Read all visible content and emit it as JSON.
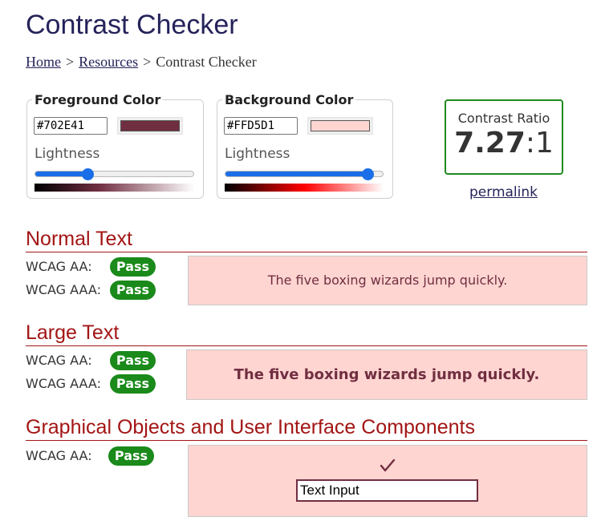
{
  "page": {
    "title": "Contrast Checker",
    "breadcrumb": {
      "home": "Home",
      "resources": "Resources",
      "current": "Contrast Checker",
      "separator": ">"
    }
  },
  "foreground": {
    "legend": "Foreground Color",
    "hex": "#702E41",
    "swatch_color": "#702e41",
    "lightness_label": "Lightness",
    "lightness_level": 0.33
  },
  "background": {
    "legend": "Background Color",
    "hex": "#FFD5D1",
    "swatch_color": "#ffd5d1",
    "lightness_label": "Lightness",
    "lightness_level": 0.9
  },
  "ratio": {
    "label": "Contrast Ratio",
    "value": "7.27",
    "suffix": ":1",
    "permalink": "permalink"
  },
  "sections": {
    "normal": {
      "heading": "Normal Text",
      "aa_label": "WCAG AA:",
      "aa_result": "Pass",
      "aaa_label": "WCAG AAA:",
      "aaa_result": "Pass",
      "preview": "The five boxing wizards jump quickly."
    },
    "large": {
      "heading": "Large Text",
      "aa_label": "WCAG AA:",
      "aa_result": "Pass",
      "aaa_label": "WCAG AAA:",
      "aaa_result": "Pass",
      "preview": "The five boxing wizards jump quickly."
    },
    "graphical": {
      "heading": "Graphical Objects and User Interface Components",
      "aa_label": "WCAG AA:",
      "aa_result": "Pass",
      "input_value": "Text Input",
      "icon": "checkmark-icon"
    }
  },
  "colors": {
    "pass": "#1a8a1a",
    "heading": "#a31515",
    "link": "#25235a",
    "ratio_border": "#1e8a1e",
    "slider": "#1a6ee8"
  }
}
